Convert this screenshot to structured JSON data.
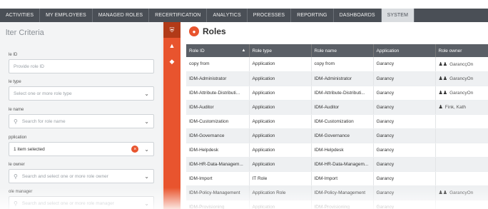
{
  "nav": {
    "tabs": [
      "ACTIVITIES",
      "MY EMPLOYEES",
      "MANAGED ROLES",
      "RECERTIFICATION",
      "ANALYTICS",
      "PROCESSES",
      "REPORTING",
      "DASHBOARDS",
      "SYSTEM"
    ],
    "active_index": 8
  },
  "filter": {
    "title": "lter Criteria",
    "fields": {
      "role_id": {
        "label": "le ID",
        "placeholder": "Provide role ID"
      },
      "role_type": {
        "label": "le type",
        "placeholder": "Select one or more role type"
      },
      "role_name": {
        "label": "le name",
        "placeholder": "Search for role name"
      },
      "application": {
        "label": "pplication",
        "value": "1 item selected"
      },
      "role_owner": {
        "label": "le owner",
        "placeholder": "Search and select one or more role owner"
      },
      "role_manager": {
        "label": "ole manager",
        "placeholder": "Search and select one or more role manager"
      }
    }
  },
  "rail": {
    "icons": [
      "shield-icon",
      "sitemap-icon",
      "tag-icon"
    ]
  },
  "main": {
    "title": "Roles",
    "columns": [
      "Role ID",
      "Role type",
      "Role name",
      "Application",
      "Role owner"
    ],
    "rows": [
      {
        "id": "copy from",
        "type": "Application",
        "name": "copy from",
        "app": "Garancy",
        "owner": "GarancçOn",
        "owner_icon": "group"
      },
      {
        "id": "IDM-Administrator",
        "type": "Application",
        "name": "IDM-Administrator",
        "app": "Garancy",
        "owner": "GarancyOn",
        "owner_icon": "group"
      },
      {
        "id": "IDM-Attribute-Distributi...",
        "type": "Application",
        "name": "IDM-Attribute-Distributi...",
        "app": "Garancy",
        "owner": "GarancyOn",
        "owner_icon": "group"
      },
      {
        "id": "IDM-Auditor",
        "type": "Application",
        "name": "IDM-Auditor",
        "app": "Garancy",
        "owner": "Fink, Kath",
        "owner_icon": "person"
      },
      {
        "id": "IDM-Customization",
        "type": "Application",
        "name": "IDM-Customization",
        "app": "Garancy",
        "owner": "",
        "owner_icon": ""
      },
      {
        "id": "IDM-Governance",
        "type": "Application",
        "name": "IDM-Governance",
        "app": "Garancy",
        "owner": "",
        "owner_icon": ""
      },
      {
        "id": "IDM-Helpdesk",
        "type": "Application",
        "name": "IDM-Helpdesk",
        "app": "Garancy",
        "owner": "",
        "owner_icon": ""
      },
      {
        "id": "IDM-HR-Data-Managem...",
        "type": "Application",
        "name": "IDM-HR-Data-Managem...",
        "app": "Garancy",
        "owner": "",
        "owner_icon": ""
      },
      {
        "id": "IDM-Import",
        "type": "IT Role",
        "name": "IDM-Import",
        "app": "Garancy",
        "owner": "",
        "owner_icon": ""
      },
      {
        "id": "IDM-Policy-Management",
        "type": "Application Role",
        "name": "IDM-Policy-Management",
        "app": "Garancy",
        "owner": "GarancyOn",
        "owner_icon": "group"
      },
      {
        "id": "IDM-Provisioning",
        "type": "Application",
        "name": "IDM-Provisioning",
        "app": "Garancy",
        "owner": "",
        "owner_icon": ""
      }
    ]
  },
  "colors": {
    "accent": "#e8542e",
    "nav_bg": "#4a4f56",
    "header_bg": "#5a5f66"
  }
}
